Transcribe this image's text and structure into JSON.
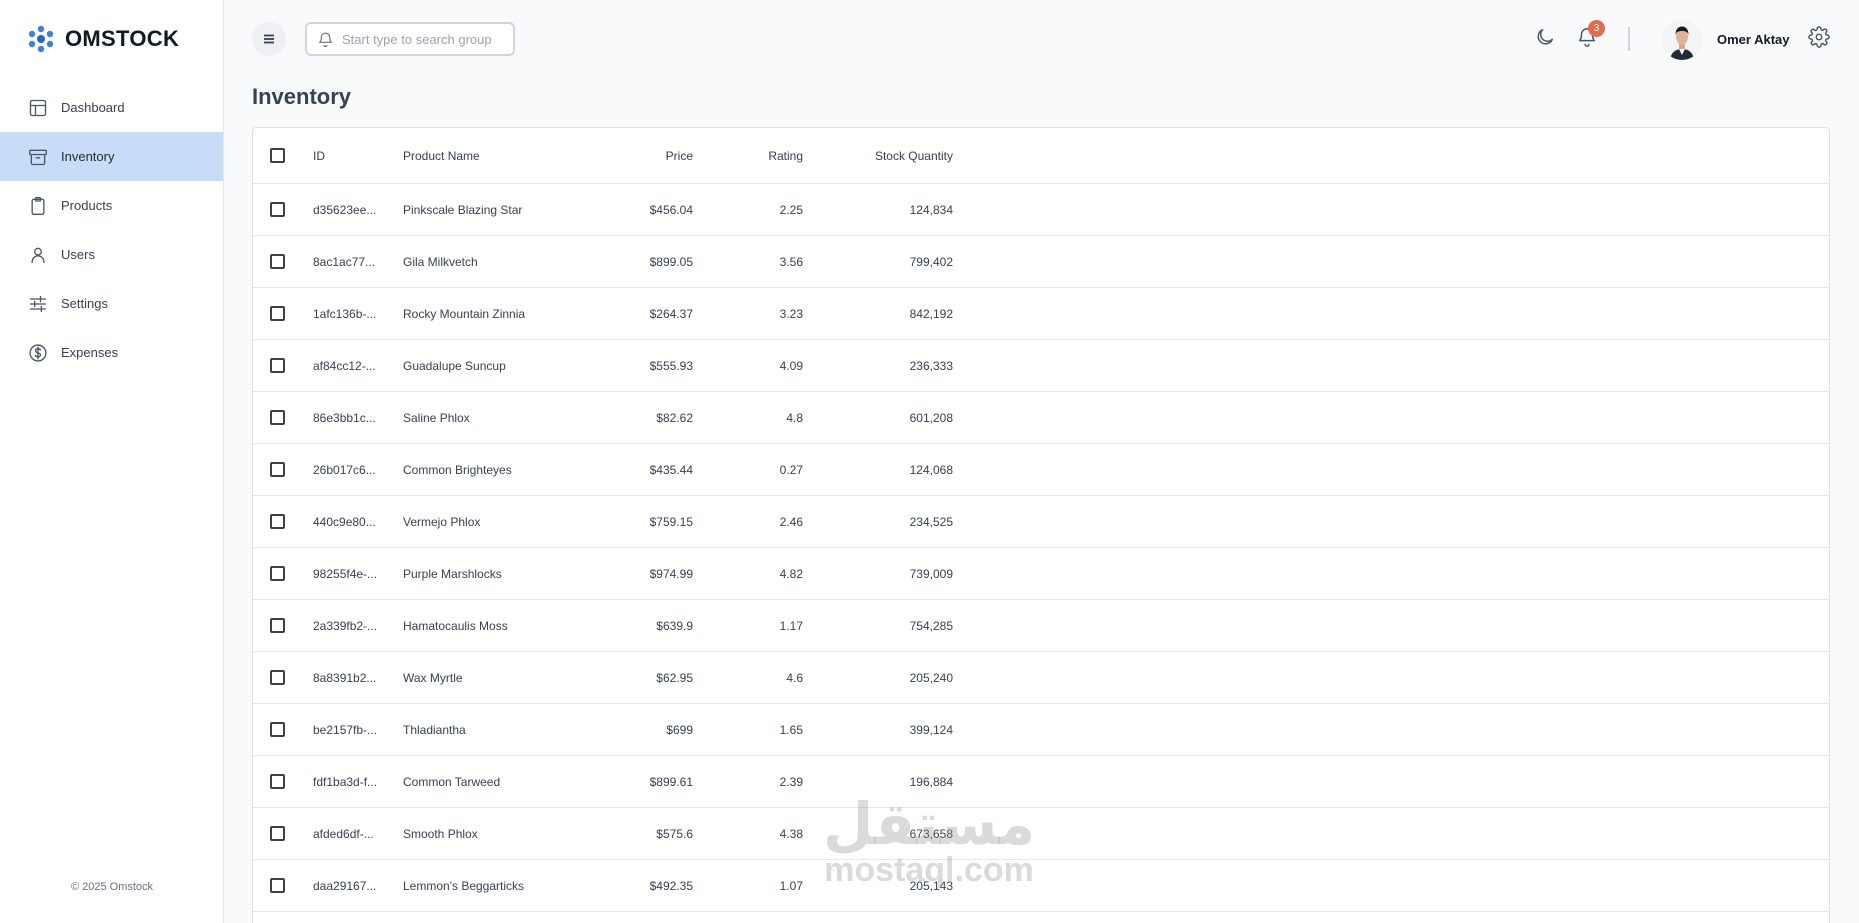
{
  "brand": {
    "name": "OMSTOCK",
    "accent": "#3b82d8"
  },
  "sidebar": {
    "items": [
      {
        "label": "Dashboard",
        "icon": "layout-icon",
        "active": false
      },
      {
        "label": "Inventory",
        "icon": "archive-icon",
        "active": true
      },
      {
        "label": "Products",
        "icon": "clipboard-icon",
        "active": false
      },
      {
        "label": "Users",
        "icon": "user-icon",
        "active": false
      },
      {
        "label": "Settings",
        "icon": "sliders-icon",
        "active": false
      },
      {
        "label": "Expenses",
        "icon": "dollar-circle-icon",
        "active": false
      }
    ],
    "active_color": "#c7dcf6",
    "footer": "© 2025 Omstock"
  },
  "topbar": {
    "search_placeholder": "Start type to search groups & products",
    "notification_count": "3",
    "badge_color": "#e06b4d",
    "user_name": "Omer Aktay"
  },
  "page": {
    "title": "Inventory"
  },
  "table": {
    "columns": [
      "ID",
      "Product Name",
      "Price",
      "Rating",
      "Stock Quantity"
    ],
    "rows": [
      {
        "id": "d35623ee...",
        "name": "Pinkscale Blazing Star",
        "price": "$456.04",
        "rating": "2.25",
        "stock": "124,834"
      },
      {
        "id": "8ac1ac77...",
        "name": "Gila Milkvetch",
        "price": "$899.05",
        "rating": "3.56",
        "stock": "799,402"
      },
      {
        "id": "1afc136b-...",
        "name": "Rocky Mountain Zinnia",
        "price": "$264.37",
        "rating": "3.23",
        "stock": "842,192"
      },
      {
        "id": "af84cc12-...",
        "name": "Guadalupe Suncup",
        "price": "$555.93",
        "rating": "4.09",
        "stock": "236,333"
      },
      {
        "id": "86e3bb1c...",
        "name": "Saline Phlox",
        "price": "$82.62",
        "rating": "4.8",
        "stock": "601,208"
      },
      {
        "id": "26b017c6...",
        "name": "Common Brighteyes",
        "price": "$435.44",
        "rating": "0.27",
        "stock": "124,068"
      },
      {
        "id": "440c9e80...",
        "name": "Vermejo Phlox",
        "price": "$759.15",
        "rating": "2.46",
        "stock": "234,525"
      },
      {
        "id": "98255f4e-...",
        "name": "Purple Marshlocks",
        "price": "$974.99",
        "rating": "4.82",
        "stock": "739,009"
      },
      {
        "id": "2a339fb2-...",
        "name": "Hamatocaulis Moss",
        "price": "$639.9",
        "rating": "1.17",
        "stock": "754,285"
      },
      {
        "id": "8a8391b2...",
        "name": "Wax Myrtle",
        "price": "$62.95",
        "rating": "4.6",
        "stock": "205,240"
      },
      {
        "id": "be2157fb-...",
        "name": "Thladiantha",
        "price": "$699",
        "rating": "1.65",
        "stock": "399,124"
      },
      {
        "id": "fdf1ba3d-f...",
        "name": "Common Tarweed",
        "price": "$899.61",
        "rating": "2.39",
        "stock": "196,884"
      },
      {
        "id": "afded6df-...",
        "name": "Smooth Phlox",
        "price": "$575.6",
        "rating": "4.38",
        "stock": "673,658"
      },
      {
        "id": "daa29167...",
        "name": "Lemmon's Beggarticks",
        "price": "$492.35",
        "rating": "1.07",
        "stock": "205,143"
      }
    ]
  },
  "watermark": {
    "arabic": "مستقل",
    "latin": "mostaql.com"
  }
}
